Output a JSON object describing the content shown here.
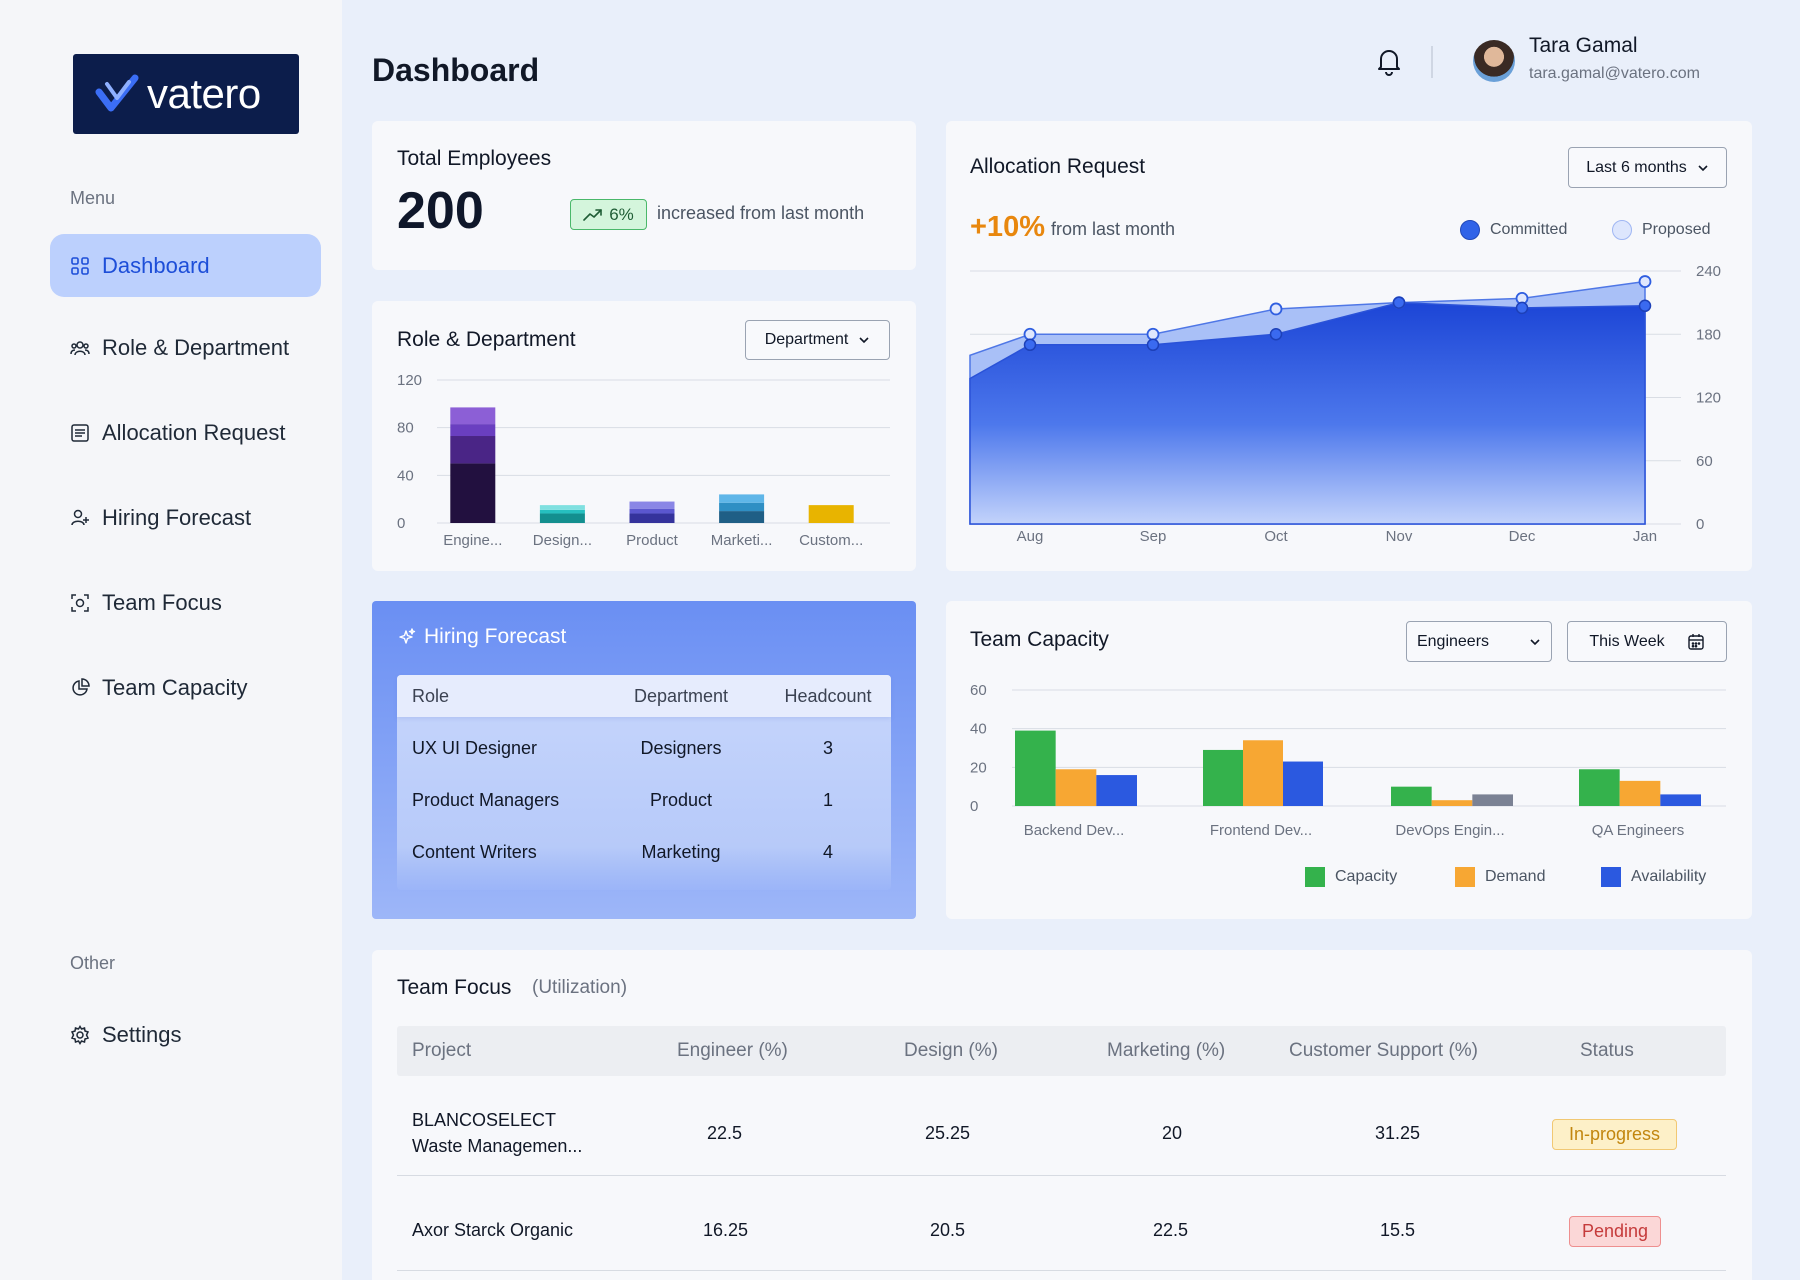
{
  "brand": {
    "name": "vatero"
  },
  "sidebar": {
    "menu_heading": "Menu",
    "items": [
      {
        "label": "Dashboard",
        "icon": "grid-icon",
        "active": true
      },
      {
        "label": "Role & Department",
        "icon": "people-icon"
      },
      {
        "label": "Allocation Request",
        "icon": "list-icon"
      },
      {
        "label": "Hiring Forecast",
        "icon": "user-plus-icon"
      },
      {
        "label": "Team Focus",
        "icon": "focus-icon"
      },
      {
        "label": "Team Capacity",
        "icon": "pie-icon"
      }
    ],
    "other_heading": "Other",
    "settings_label": "Settings"
  },
  "header": {
    "title": "Dashboard",
    "user": {
      "name": "Tara Gamal",
      "email": "tara.gamal@vatero.com"
    }
  },
  "total_employees": {
    "title": "Total Employees",
    "value": "200",
    "change": "6%",
    "change_text": "increased from last month"
  },
  "role_department": {
    "title": "Role & Department",
    "dropdown": "Department"
  },
  "allocation": {
    "title": "Allocation Request",
    "dropdown": "Last 6 months",
    "change": "+10%",
    "change_text": "from last month",
    "legend": [
      "Committed",
      "Proposed"
    ]
  },
  "hiring_forecast": {
    "title": "Hiring Forecast",
    "columns": [
      "Role",
      "Department",
      "Headcount"
    ],
    "rows": [
      {
        "role": "UX UI Designer",
        "department": "Designers",
        "headcount": "3"
      },
      {
        "role": "Product Managers",
        "department": "Product",
        "headcount": "1"
      },
      {
        "role": "Content Writers",
        "department": "Marketing",
        "headcount": "4"
      }
    ]
  },
  "team_capacity": {
    "title": "Team Capacity",
    "dropdown": "Engineers",
    "period": "This Week",
    "legend": [
      "Capacity",
      "Demand",
      "Availability"
    ]
  },
  "team_focus": {
    "title": "Team Focus",
    "subtitle": "(Utilization)",
    "columns": [
      "Project",
      "Engineer (%)",
      "Design (%)",
      "Marketing (%)",
      "Customer Support (%)",
      "Status"
    ],
    "rows": [
      {
        "project_l1": "BLANCOSELECT",
        "project_l2": "Waste Managemen...",
        "engineer": "22.5",
        "design": "25.25",
        "marketing": "20",
        "support": "31.25",
        "status": "In-progress"
      },
      {
        "project_l1": "Axor Starck Organic",
        "project_l2": "",
        "engineer": "16.25",
        "design": "20.5",
        "marketing": "22.5",
        "support": "15.5",
        "status": "Pending"
      }
    ]
  },
  "colors": {
    "primary": "#1d4ed8",
    "active_bg": "#bcd0fd",
    "accent_orange": "#e8870e",
    "capacity": "#34b24c",
    "demand": "#f7a733",
    "availability": "#2b59e0"
  },
  "chart_data": [
    {
      "type": "bar",
      "stacked": true,
      "categories": [
        "Engine...",
        "Design...",
        "Product",
        "Marketi...",
        "Custom..."
      ],
      "series": [
        {
          "values": [
            50,
            8,
            8,
            10,
            15
          ]
        },
        {
          "values": [
            23,
            3,
            4,
            7,
            0
          ]
        },
        {
          "values": [
            10,
            4,
            6,
            7,
            0
          ]
        },
        {
          "values": [
            14,
            0,
            0,
            0,
            0
          ]
        }
      ],
      "ylim": [
        0,
        120
      ],
      "yticks": [
        0,
        40,
        80,
        120
      ],
      "grid": true
    },
    {
      "type": "area",
      "x": [
        "Aug",
        "Sep",
        "Oct",
        "Nov",
        "Dec",
        "Jan"
      ],
      "series": [
        {
          "name": "Committed",
          "values": [
            170,
            170,
            180,
            210,
            205,
            207
          ]
        },
        {
          "name": "Proposed",
          "values": [
            180,
            180,
            204,
            210,
            214,
            230
          ]
        }
      ],
      "start_values": {
        "Committed": 138,
        "Proposed": 160
      },
      "ylim": [
        0,
        240
      ],
      "yticks": [
        0,
        60,
        120,
        180,
        240
      ],
      "y_axis_side": "right",
      "grid": true,
      "legend": "top-right"
    },
    {
      "type": "bar",
      "categories": [
        "Backend Dev...",
        "Frontend Dev...",
        "DevOps Engin...",
        "QA Engineers"
      ],
      "series": [
        {
          "name": "Capacity",
          "values": [
            39,
            29,
            10,
            19
          ]
        },
        {
          "name": "Demand",
          "values": [
            19,
            34,
            3,
            13
          ]
        },
        {
          "name": "Availability",
          "values": [
            16,
            23,
            6,
            6
          ]
        }
      ],
      "ylim": [
        0,
        60
      ],
      "yticks": [
        0,
        20,
        40,
        60
      ],
      "grid": true,
      "legend": "bottom-right"
    }
  ]
}
